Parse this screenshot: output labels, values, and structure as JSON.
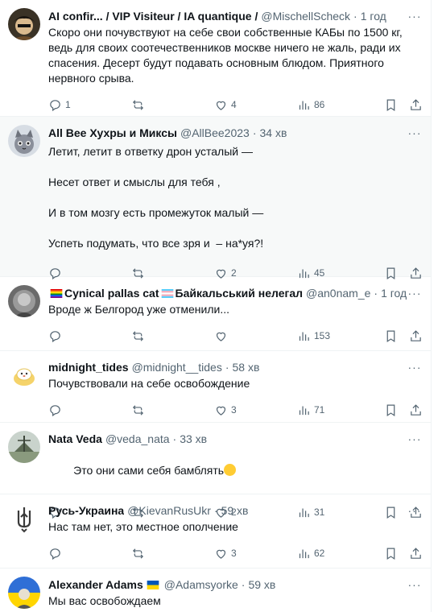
{
  "tweets": [
    {
      "name": "AI confir... / VIP Visiteur / IA quantique /",
      "handle": "@MischellScheck",
      "time": "1 год",
      "text": "Скоро они почувствуют на себе свои собственные КАБы по 1500 кг, ведь для своих соотечественников москве ничего не жаль, ради их спасения. Десерт будут подавать основным блюдом. Приятного нервного срыва.",
      "replies": "1",
      "retweets": "",
      "likes": "4",
      "views": "86"
    },
    {
      "name": "All Bee Хухры и Миксы",
      "handle": "@AllBee2023",
      "time": "34 хв",
      "text": "Летит, летит в ответку дрон усталый —\n\nНесет ответ и смыслы для тебя ,\n\nИ в том мозгу есть промежуток малый —\n\nУспеть подумать, что все зря и  – на*уя?!",
      "replies": "",
      "retweets": "",
      "likes": "2",
      "views": "45"
    },
    {
      "name_part1": "Cynical pallas cat",
      "name_part2": "Байкальський нелегал",
      "handle": "@an0nam_e",
      "time": "1 год",
      "text": "Вроде ж Белгород уже отменили...",
      "replies": "",
      "retweets": "",
      "likes": "",
      "views": "153"
    },
    {
      "name": "midnight_tides",
      "handle": "@midnight__tides",
      "time": "58 хв",
      "text": "Почувствовали на себе освобождение",
      "replies": "",
      "retweets": "",
      "likes": "3",
      "views": "71"
    },
    {
      "name": "Nata Veda",
      "handle": "@veda_nata",
      "time": "33 хв",
      "text": "Это они сами себя бамблять",
      "replies": "",
      "retweets": "",
      "likes": "2",
      "views": "31"
    },
    {
      "name": "Русь-Украина",
      "handle": "@KievanRusUkr",
      "time": "59 хв",
      "text": "Нас там нет, это местное ополчение",
      "replies": "",
      "retweets": "",
      "likes": "3",
      "views": "62"
    },
    {
      "name": "Alexander Adams",
      "handle": "@Adamsyorke",
      "time": "59 хв",
      "text": "Мы вас освобождаем"
    }
  ],
  "ui": {
    "dot": "·",
    "more": "···"
  },
  "colors": {
    "text": "#0f1419",
    "secondary": "#536471",
    "border": "#eff3f4",
    "highlight_bg": "#f7f9f9"
  },
  "icons": [
    "reply-icon",
    "retweet-icon",
    "like-icon",
    "views-icon",
    "bookmark-icon",
    "share-icon",
    "more-icon"
  ]
}
